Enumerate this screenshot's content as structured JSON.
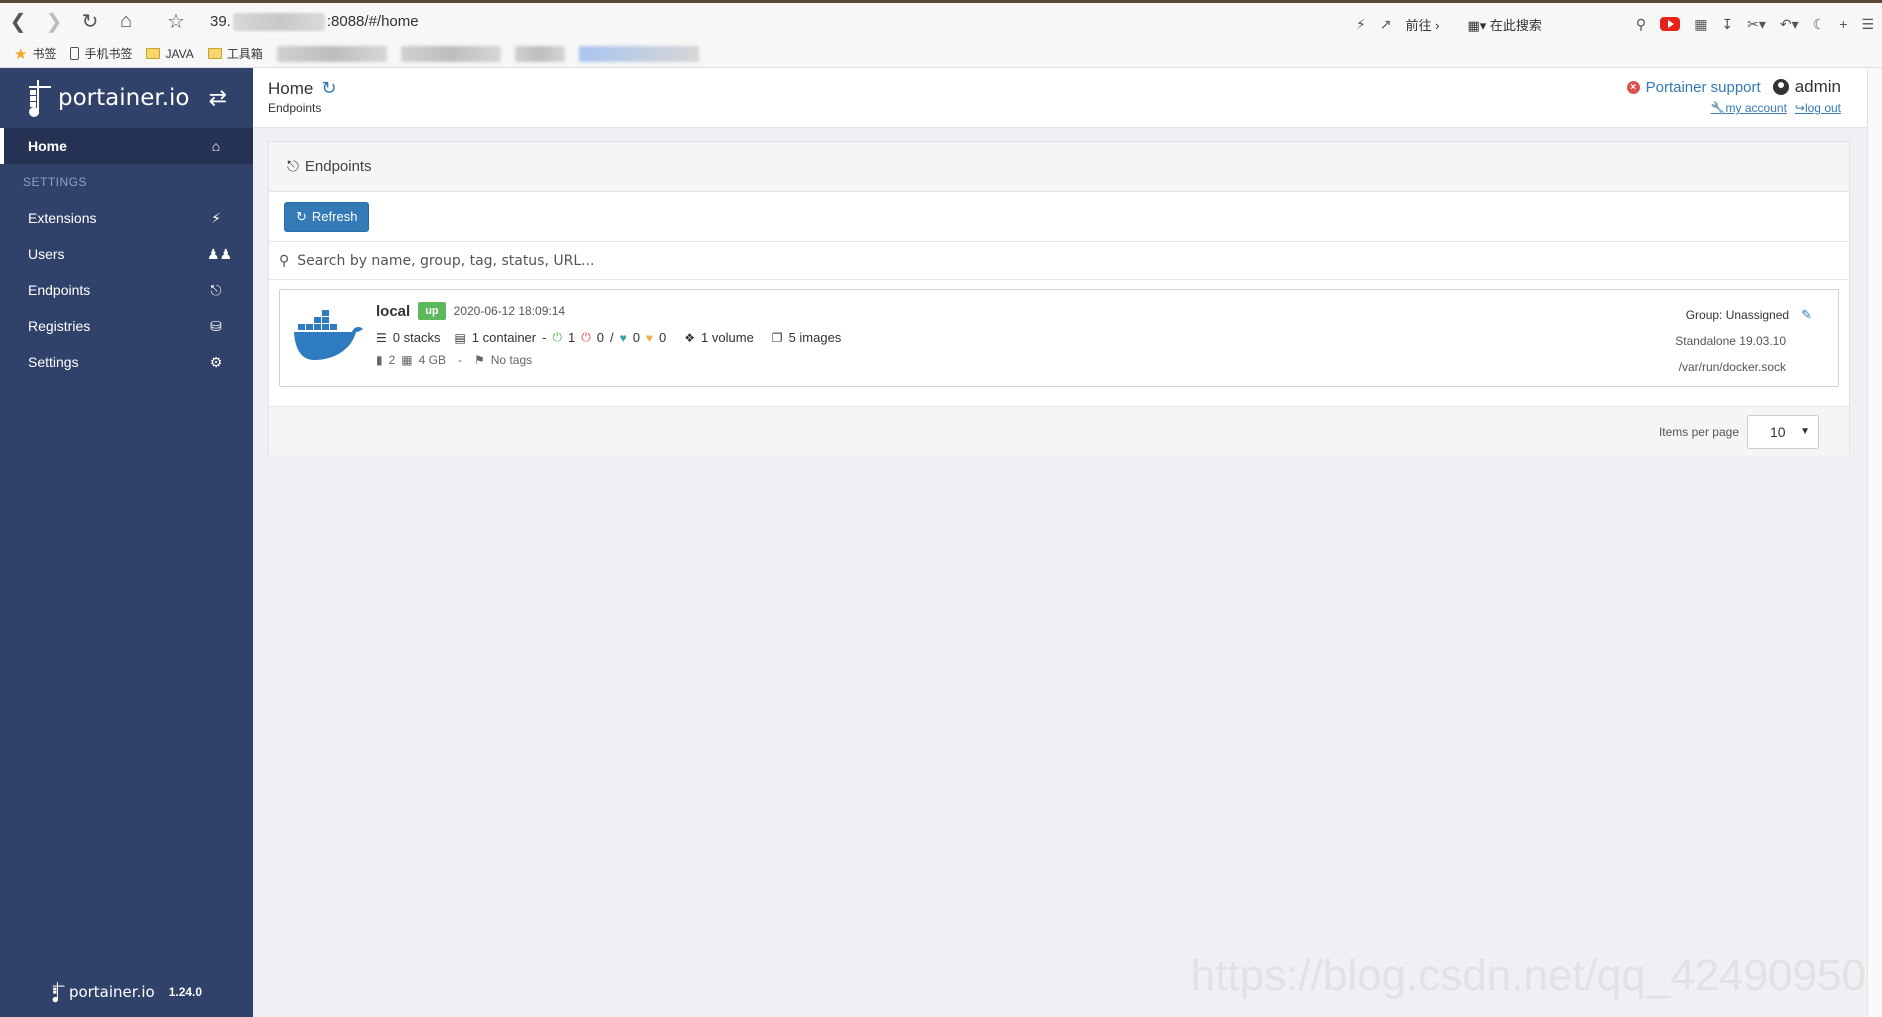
{
  "browser": {
    "url_prefix": "39.",
    "url_suffix": ":8088/#/home",
    "goto_label": "前往",
    "search_label": "在此搜索",
    "bookmarks": {
      "bookmarks_label": "书签",
      "mobile_label": "手机书签",
      "java_label": "JAVA",
      "tools_label": "工具箱"
    }
  },
  "sidebar": {
    "brand": "portainer.io",
    "items": [
      {
        "label": "Home",
        "icon": "home-icon"
      },
      {
        "label": "Extensions",
        "icon": "bolt-icon"
      },
      {
        "label": "Users",
        "icon": "users-icon"
      },
      {
        "label": "Endpoints",
        "icon": "plug-icon"
      },
      {
        "label": "Registries",
        "icon": "database-icon"
      },
      {
        "label": "Settings",
        "icon": "cogs-icon"
      }
    ],
    "settings_heading": "SETTINGS",
    "footer_brand": "portainer.io",
    "version": "1.24.0"
  },
  "header": {
    "title": "Home",
    "breadcrumb": "Endpoints",
    "support_label": "Portainer support",
    "username": "admin",
    "my_account_label": "my account",
    "logout_label": "log out"
  },
  "endpoints_widget": {
    "title": "Endpoints",
    "refresh_label": "Refresh",
    "search_placeholder": "Search by name, group, tag, status, URL...",
    "endpoint": {
      "name": "local",
      "status": "up",
      "timestamp": "2020-06-12 18:09:14",
      "stacks": "0 stacks",
      "containers": "1 container",
      "running": "1",
      "stopped": "0",
      "separator": "/",
      "healthy": "0",
      "unhealthy": "0",
      "volumes": "1 volume",
      "images": "5 images",
      "cpu": "2",
      "memory": "4 GB",
      "dash": "-",
      "tags": "No tags",
      "group": "Group: Unassigned",
      "version": "Standalone 19.03.10",
      "url": "/var/run/docker.sock"
    },
    "items_per_page_label": "Items per page",
    "items_per_page_value": "10"
  },
  "watermark": "https://blog.csdn.net/qq_42490950",
  "colors": {
    "sidebar": "#30426a",
    "primary": "#337ab7",
    "success": "#5cb85c",
    "danger": "#d9534f"
  }
}
